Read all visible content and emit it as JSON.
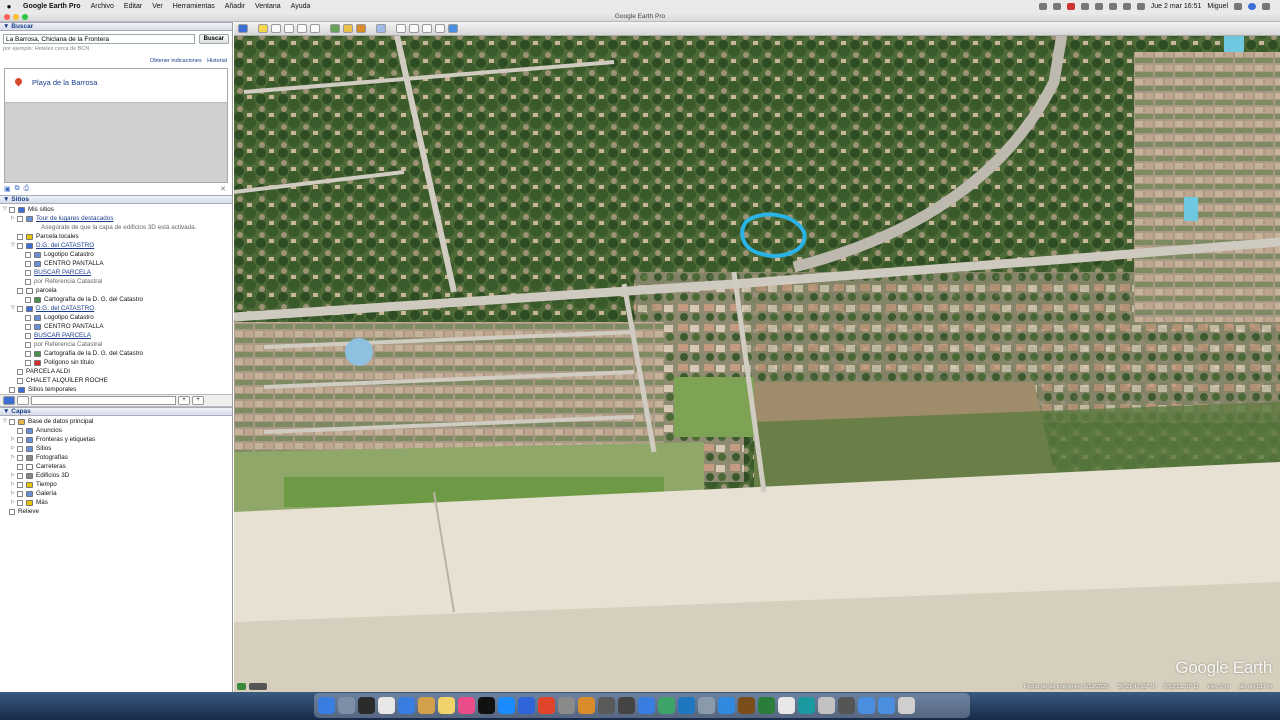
{
  "menubar": {
    "app_name": "Google Earth Pro",
    "items": [
      "Archivo",
      "Editar",
      "Ver",
      "Herramientas",
      "Añadir",
      "Ventana",
      "Ayuda"
    ],
    "datetime": "Jue 2 mar  16:51",
    "user": "Miguel"
  },
  "window": {
    "title": "Google Earth Pro"
  },
  "search": {
    "header": "Buscar",
    "value": "La Barrosa, Chiclana de la Frontera",
    "button": "Buscar",
    "hint": "por ejemplo: Hoteles cerca de BCN",
    "link_directions": "Obtener indicaciones",
    "link_history": "Historial",
    "result": "Playa de la Barrosa"
  },
  "places": {
    "header": "Sitios",
    "items": [
      {
        "label": "Mis sitios",
        "style": "normal",
        "icon_color": "#3b6fd6",
        "indent": 0,
        "toggle": "▽"
      },
      {
        "label": "Tour de lugares destacados",
        "style": "link",
        "icon_color": "#6a8fd6",
        "indent": 1,
        "toggle": "▷"
      },
      {
        "label": "Asegúrate de que la capa de edificios 3D está activada.",
        "style": "note",
        "icon_color": "",
        "indent": 2,
        "toggle": ""
      },
      {
        "label": "Parcela locales",
        "style": "normal",
        "icon_color": "#e5c400",
        "indent": 1,
        "toggle": ""
      },
      {
        "label": "D.G. del CATASTRO",
        "style": "link",
        "icon_color": "#3b6fd6",
        "indent": 1,
        "toggle": "▽"
      },
      {
        "label": "Logotipo Catastro",
        "style": "normal",
        "icon_color": "#6a8fd6",
        "indent": 2,
        "toggle": ""
      },
      {
        "label": "CENTRO PANTALLA",
        "style": "normal",
        "icon_color": "#6a8fd6",
        "indent": 2,
        "toggle": ""
      },
      {
        "label": "BUSCAR PARCELA",
        "style": "link",
        "icon_color": "",
        "indent": 2,
        "toggle": ""
      },
      {
        "label": "por Referencia Catastral",
        "style": "gray",
        "icon_color": "",
        "indent": 2,
        "toggle": ""
      },
      {
        "label": "parcela",
        "style": "normal",
        "icon_color": "#ffffff",
        "indent": 1,
        "toggle": ""
      },
      {
        "label": "Cartografía de la D. G. del Catastro",
        "style": "normal",
        "icon_color": "#4d8f4d",
        "indent": 2,
        "toggle": ""
      },
      {
        "label": "D.G. del CATASTRO",
        "style": "link",
        "icon_color": "#3b6fd6",
        "indent": 1,
        "toggle": "▽"
      },
      {
        "label": "Logotipo Catastro",
        "style": "normal",
        "icon_color": "#6a8fd6",
        "indent": 2,
        "toggle": ""
      },
      {
        "label": "CENTRO PANTALLA",
        "style": "normal",
        "icon_color": "#6a8fd6",
        "indent": 2,
        "toggle": ""
      },
      {
        "label": "BUSCAR PARCELA",
        "style": "link",
        "icon_color": "",
        "indent": 2,
        "toggle": ""
      },
      {
        "label": "por Referencia Catastral",
        "style": "gray",
        "icon_color": "",
        "indent": 2,
        "toggle": ""
      },
      {
        "label": "Cartografía de la D. G. del Catastro",
        "style": "normal",
        "icon_color": "#4d8f4d",
        "indent": 2,
        "toggle": ""
      },
      {
        "label": "Polígono sin título",
        "style": "normal",
        "icon_color": "#d62b2b",
        "indent": 2,
        "toggle": ""
      },
      {
        "label": "PARCELA ALDI",
        "style": "normal",
        "icon_color": "",
        "indent": 1,
        "toggle": ""
      },
      {
        "label": "CHALET ALQUILER ROCHE",
        "style": "normal",
        "icon_color": "",
        "indent": 1,
        "toggle": ""
      },
      {
        "label": "Sitios temporales",
        "style": "normal",
        "icon_color": "#3b6fd6",
        "indent": 0,
        "toggle": ""
      }
    ]
  },
  "layers": {
    "header": "Capas",
    "items": [
      {
        "label": "Base de datos principal",
        "icon_color": "#e5b84a",
        "indent": 0,
        "toggle": "▽"
      },
      {
        "label": "Anuncios",
        "icon_color": "#6a8fd6",
        "indent": 1,
        "toggle": ""
      },
      {
        "label": "Fronteras y etiquetas",
        "icon_color": "#6a8fd6",
        "indent": 1,
        "toggle": "▷"
      },
      {
        "label": "Sitios",
        "icon_color": "#6a8fd6",
        "indent": 1,
        "toggle": "▷"
      },
      {
        "label": "Fotografías",
        "icon_color": "#888888",
        "indent": 1,
        "toggle": "▷"
      },
      {
        "label": "Carreteras",
        "icon_color": "#ffffff",
        "indent": 1,
        "toggle": ""
      },
      {
        "label": "Edificios 3D",
        "icon_color": "#888888",
        "indent": 1,
        "toggle": "▷"
      },
      {
        "label": "Tiempo",
        "icon_color": "#e5c400",
        "indent": 1,
        "toggle": "▷"
      },
      {
        "label": "Galería",
        "icon_color": "#6a8fd6",
        "indent": 1,
        "toggle": "▷"
      },
      {
        "label": "Más",
        "icon_color": "#e5c400",
        "indent": 1,
        "toggle": "▷"
      },
      {
        "label": "Relieve",
        "icon_color": "",
        "indent": 0,
        "toggle": ""
      }
    ]
  },
  "map": {
    "logo": "Google Earth",
    "imagery_date": "Fecha de las imágenes: 6/10/2020",
    "lat": "36°21'47.65\" N",
    "lon": "6°10'21.70\" O",
    "elev": "elev.   0 m",
    "eye_alt": "alt. ojo   517 m",
    "annotation_color": "#2ab3e6"
  },
  "dock": {
    "icon_colors": [
      "#3a7de0",
      "#7d8ea6",
      "#2b2b2b",
      "#e8e8e8",
      "#3a7de0",
      "#d2a04a",
      "#f0d36b",
      "#ea4c89",
      "#111111",
      "#1a8cff",
      "#2e66d9",
      "#e0452b",
      "#8a8a8a",
      "#d88c2a",
      "#5a5a5a",
      "#444444",
      "#3a7de0",
      "#3fa46a",
      "#1f77c2",
      "#8a9aaa",
      "#2f8ae0",
      "#7a4d1a",
      "#2a7d3a",
      "#e8e8e8",
      "#1a9aa0",
      "#c2c2c2",
      "#555555",
      "#4a8ee0",
      "#4a8ee0",
      "#cfcfcf"
    ]
  }
}
